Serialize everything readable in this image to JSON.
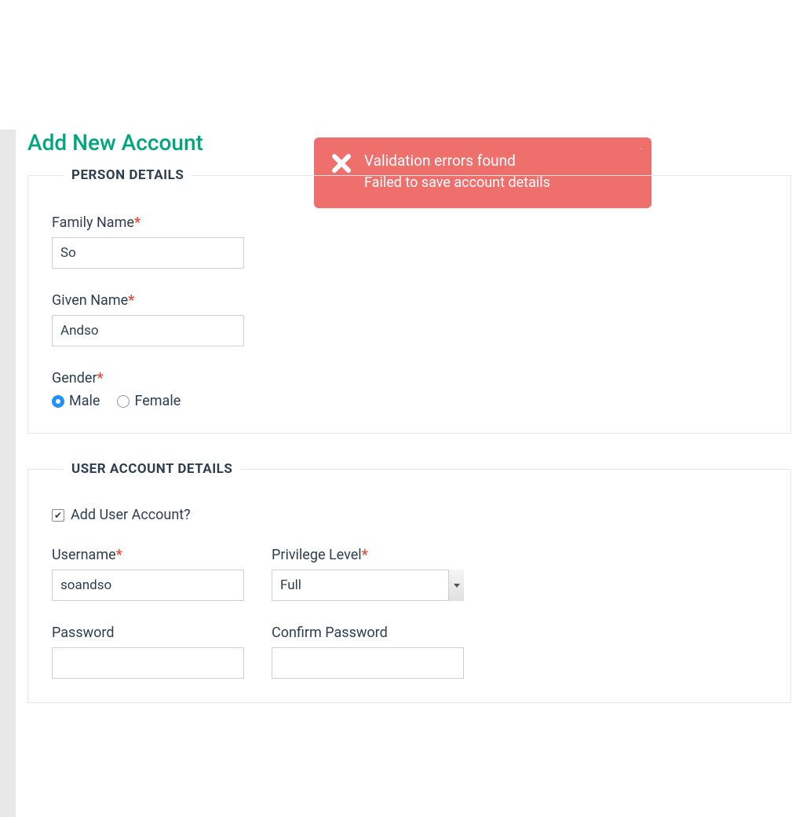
{
  "toast": {
    "title": "Validation errors found",
    "message": "Failed to save account details"
  },
  "page": {
    "title": "Add New Account"
  },
  "sections": {
    "person": {
      "legend": "PERSON DETAILS",
      "family_name_label": "Family Name",
      "family_name_value": "So",
      "given_name_label": "Given Name",
      "given_name_value": "Andso",
      "gender_label": "Gender",
      "gender_options": {
        "male": "Male",
        "female": "Female"
      },
      "gender_selected": "male"
    },
    "account": {
      "legend": "USER ACCOUNT DETAILS",
      "add_user_label": "Add User Account?",
      "add_user_checked": true,
      "username_label": "Username",
      "username_value": "soandso",
      "privilege_label": "Privilege Level",
      "privilege_value": "Full",
      "password_label": "Password",
      "password_value": "",
      "confirm_password_label": "Confirm Password",
      "confirm_password_value": ""
    }
  },
  "required_marker": "*"
}
